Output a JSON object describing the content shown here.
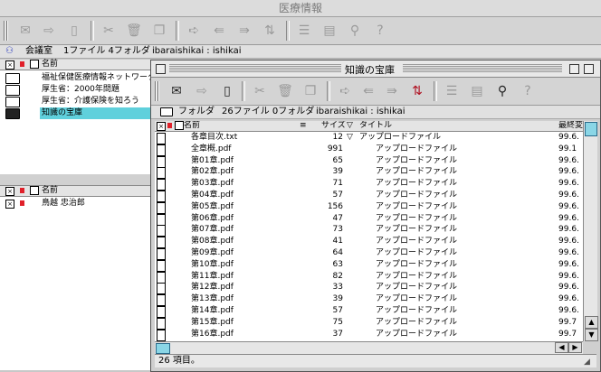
{
  "app": {
    "title": "医療情報"
  },
  "outer": {
    "path": {
      "name": "会議室",
      "counts": "1ファイル 4フォルダ",
      "user": "ibaraishikai : ishikai"
    },
    "upper_list": {
      "column_name": "名前",
      "items": [
        {
          "label": "福祉保健医療情報ネットワーク",
          "icon": "folder-icon"
        },
        {
          "label": "厚生省：2000年問題",
          "icon": "folder-icon"
        },
        {
          "label": "厚生省：介護保険を知ろう",
          "icon": "folder-icon"
        },
        {
          "label": "知識の宝庫",
          "icon": "folder-icon",
          "selected": true
        }
      ]
    },
    "lower_list": {
      "column_name": "名前",
      "items": [
        {
          "label": "鳥越 忠治郎"
        }
      ]
    }
  },
  "inner": {
    "title": "知識の宝庫",
    "path": {
      "name": "フォルダ",
      "counts": "26ファイル 0フォルダ",
      "user": "ibaraishikai : ishikai"
    },
    "columns": {
      "name": "名前",
      "size": "サイズ",
      "type": "タイトル",
      "date": "最終変"
    },
    "rows": [
      {
        "name": "各章目次.txt",
        "size": "12",
        "title": "アップロードファイル",
        "date": "99.6."
      },
      {
        "name": "全章概.pdf",
        "size": "991",
        "title": "アップロードファイル",
        "date": "99.1"
      },
      {
        "name": "第01章.pdf",
        "size": "65",
        "title": "アップロードファイル",
        "date": "99.6."
      },
      {
        "name": "第02章.pdf",
        "size": "39",
        "title": "アップロードファイル",
        "date": "99.6."
      },
      {
        "name": "第03章.pdf",
        "size": "71",
        "title": "アップロードファイル",
        "date": "99.6."
      },
      {
        "name": "第04章.pdf",
        "size": "57",
        "title": "アップロードファイル",
        "date": "99.6."
      },
      {
        "name": "第05章.pdf",
        "size": "156",
        "title": "アップロードファイル",
        "date": "99.6."
      },
      {
        "name": "第06章.pdf",
        "size": "47",
        "title": "アップロードファイル",
        "date": "99.6."
      },
      {
        "name": "第07章.pdf",
        "size": "73",
        "title": "アップロードファイル",
        "date": "99.6."
      },
      {
        "name": "第08章.pdf",
        "size": "41",
        "title": "アップロードファイル",
        "date": "99.6."
      },
      {
        "name": "第09章.pdf",
        "size": "64",
        "title": "アップロードファイル",
        "date": "99.6."
      },
      {
        "name": "第10章.pdf",
        "size": "63",
        "title": "アップロードファイル",
        "date": "99.6."
      },
      {
        "name": "第11章.pdf",
        "size": "82",
        "title": "アップロードファイル",
        "date": "99.6."
      },
      {
        "name": "第12章.pdf",
        "size": "33",
        "title": "アップロードファイル",
        "date": "99.6."
      },
      {
        "name": "第13章.pdf",
        "size": "39",
        "title": "アップロードファイル",
        "date": "99.6."
      },
      {
        "name": "第14章.pdf",
        "size": "57",
        "title": "アップロードファイル",
        "date": "99.6."
      },
      {
        "name": "第15章.pdf",
        "size": "75",
        "title": "アップロードファイル",
        "date": "99.7"
      },
      {
        "name": "第16章.pdf",
        "size": "37",
        "title": "アップロードファイル",
        "date": "99.7"
      }
    ],
    "status": "26 項目。"
  },
  "colors": {
    "selection": "#5fd0dc",
    "flag": "#e0202a"
  }
}
